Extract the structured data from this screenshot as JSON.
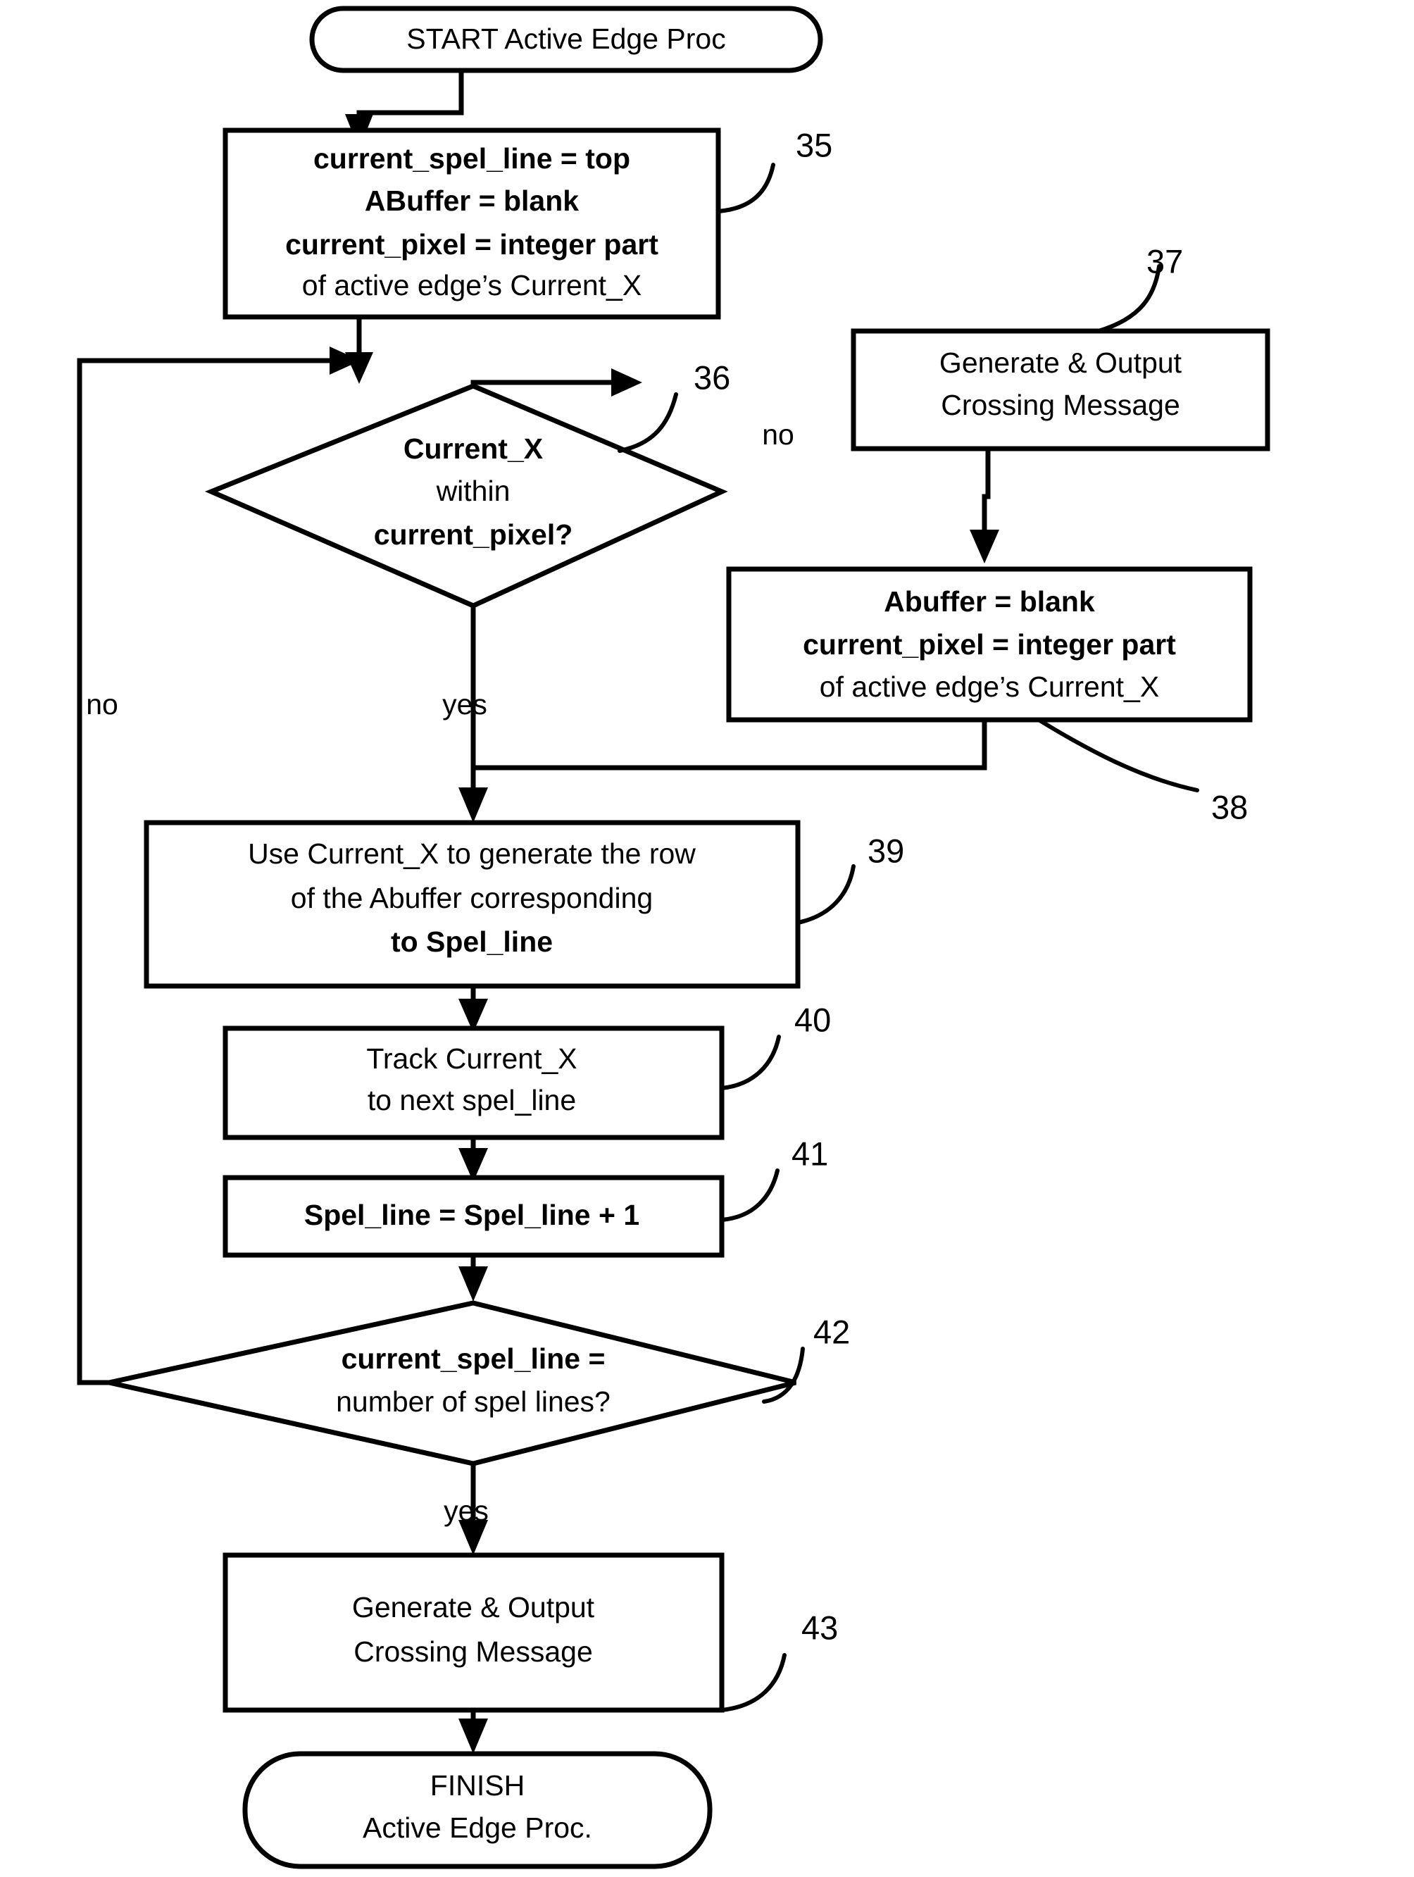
{
  "diagram": {
    "title": "Active Edge Proc Flowchart",
    "stroke_color": "#000000",
    "fill_color": "#ffffff",
    "nodes": {
      "start": {
        "ref": "",
        "type": "terminator",
        "line1": "START Active Edge Proc"
      },
      "n35": {
        "ref": "35",
        "type": "process",
        "line1": "current_spel_line = top",
        "line2": "ABuffer = blank",
        "line3": "current_pixel = integer part",
        "line4": "of active edge’s Current_X"
      },
      "n36": {
        "ref": "36",
        "type": "decision",
        "line1": "Current_X",
        "line2": "within",
        "line3": "current_pixel?"
      },
      "n37": {
        "ref": "37",
        "type": "process",
        "line1": "Generate & Output",
        "line2": "Crossing Message"
      },
      "n38": {
        "ref": "38",
        "type": "process",
        "line1": "Abuffer = blank",
        "line2": "current_pixel = integer part",
        "line3": "of active edge’s Current_X"
      },
      "n39": {
        "ref": "39",
        "type": "process",
        "line1": "Use Current_X to generate the row",
        "line2": "of the Abuffer corresponding",
        "line3": "to Spel_line"
      },
      "n40": {
        "ref": "40",
        "type": "process",
        "line1": "Track Current_X",
        "line2": "to next spel_line"
      },
      "n41": {
        "ref": "41",
        "type": "process",
        "line1": "Spel_line = Spel_line + 1"
      },
      "n42": {
        "ref": "42",
        "type": "decision",
        "line1": "current_spel_line =",
        "line2": "number of spel lines?"
      },
      "n43": {
        "ref": "43",
        "type": "process",
        "line1": "Generate & Output",
        "line2": "Crossing Message"
      },
      "finish": {
        "ref": "",
        "type": "terminator",
        "line1": "FINISH",
        "line2": "Active Edge Proc."
      }
    },
    "edge_labels": {
      "d36_no": "no",
      "d36_yes": "yes",
      "d42_no": "no",
      "d42_yes": "yes"
    }
  }
}
